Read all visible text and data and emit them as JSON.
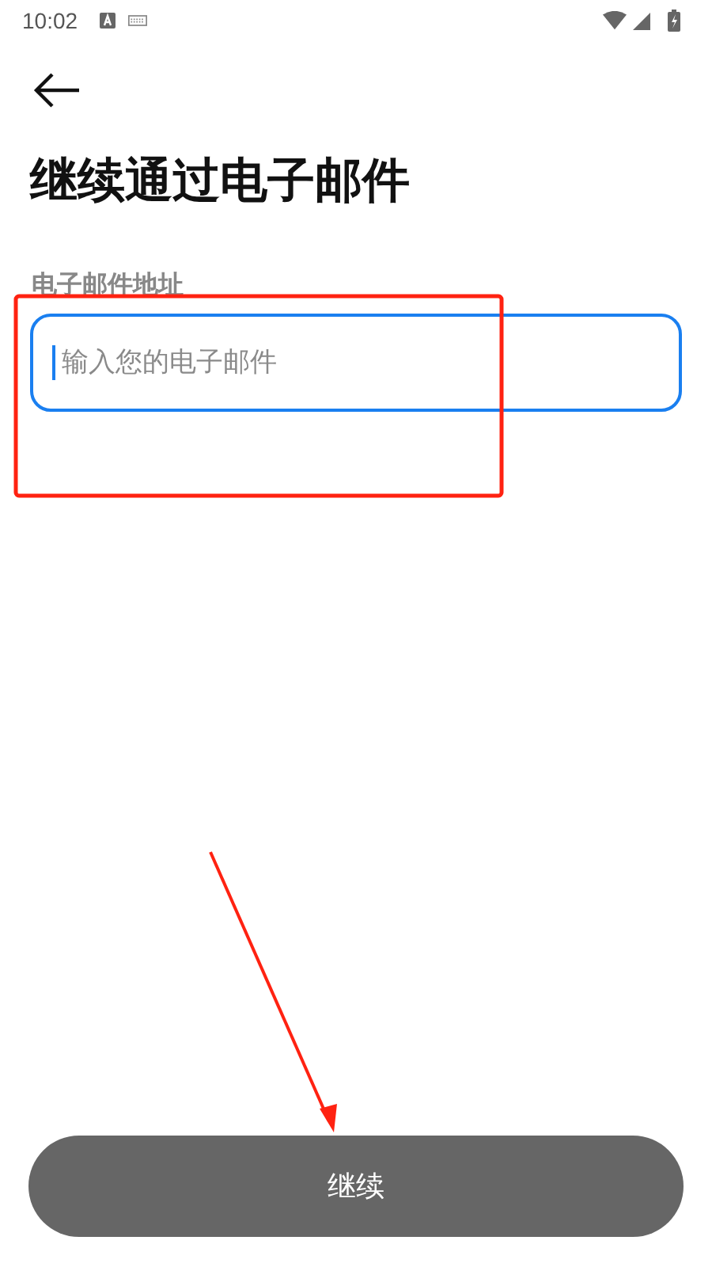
{
  "status_bar": {
    "time": "10:02"
  },
  "header": {
    "title": "继续通过电子邮件"
  },
  "email_field": {
    "label": "电子邮件地址",
    "placeholder": "输入您的电子邮件",
    "focused": true
  },
  "continue_button": {
    "label": "继续"
  }
}
